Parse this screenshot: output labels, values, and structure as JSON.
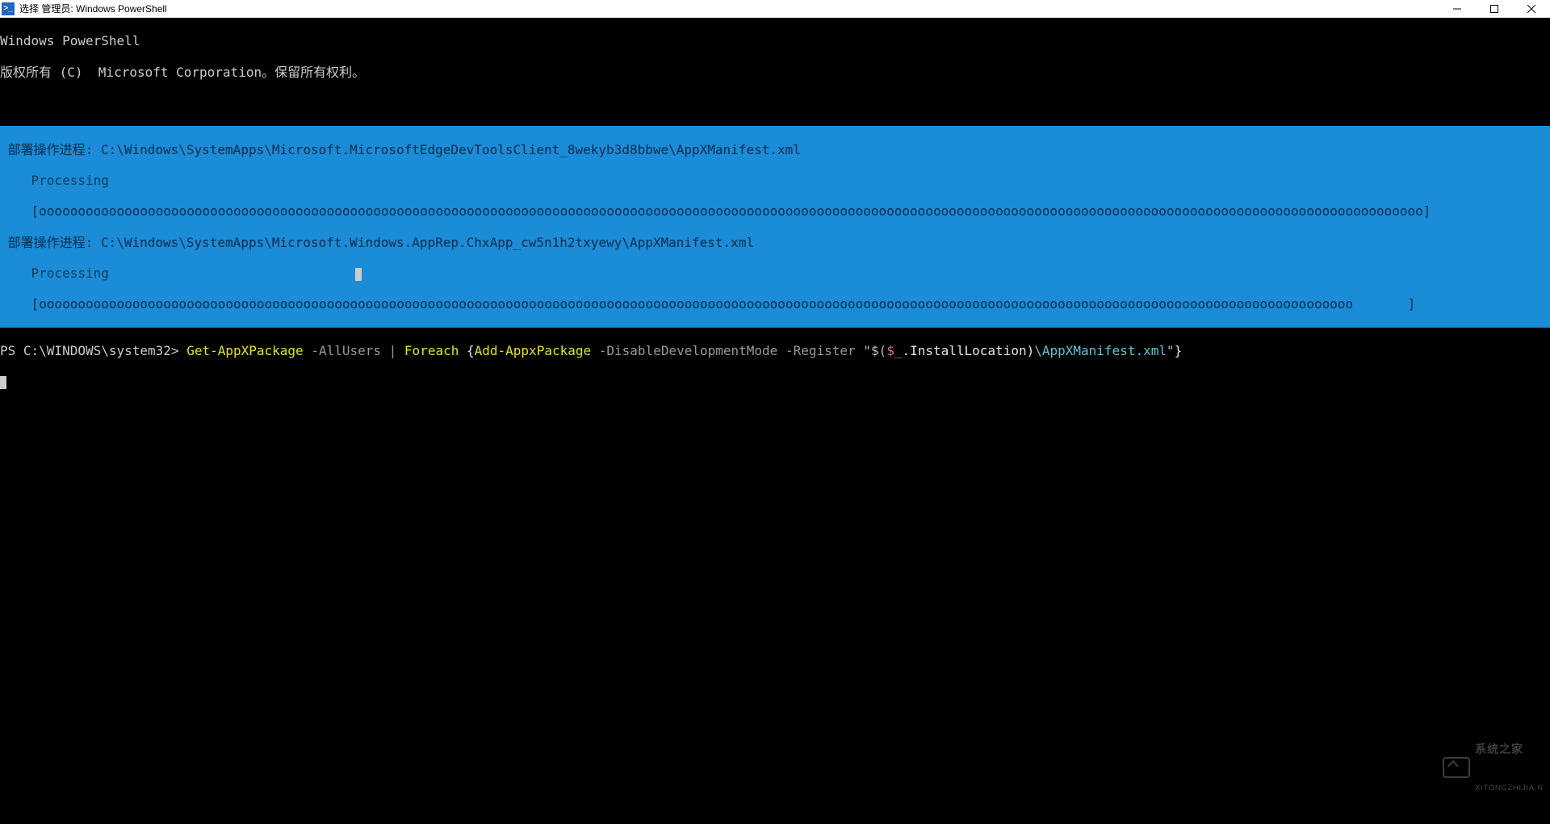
{
  "titlebar": {
    "icon_letter": ">_",
    "title": "选择 管理员: Windows PowerShell"
  },
  "header": {
    "line1": "Windows PowerShell",
    "line2": "版权所有 (C)  Microsoft Corporation。保留所有权利。"
  },
  "deploy": {
    "label": "部署操作进程:",
    "path1": "C:\\Windows\\SystemApps\\Microsoft.MicrosoftEdgeDevToolsClient_8wekyb3d8bbwe\\AppXManifest.xml",
    "path2": "C:\\Windows\\SystemApps\\Microsoft.Windows.AppRep.ChxApp_cw5n1h2txyewy\\AppXManifest.xml",
    "processing": "Processing",
    "bar1": "    [oooooooooooooooooooooooooooooooooooooooooooooooooooooooooooooooooooooooooooooooooooooooooooooooooooooooooooooooooooooooooooooooooooooooooooooooooooooooooooooooooooooooooooooooooo]",
    "bar2": "    [ooooooooooooooooooooooooooooooooooooooooooooooooooooooooooooooooooooooooooooooooooooooooooooooooooooooooooooooooooooooooooooooooooooooooooooooooooooooooooooooooooooooooo       ]"
  },
  "cmd": {
    "prompt": "PS C:\\WINDOWS\\system32> ",
    "get": "Get-AppXPackage",
    "allusers": " -AllUsers ",
    "pipe": "| ",
    "foreach": "Foreach",
    "brace_open": " {",
    "add": "Add-AppxPackage",
    "disable": " -DisableDevelopmentMode -Register ",
    "qstart": "\"$(",
    "var": "$_",
    "dot": ".",
    "prop": "InstallLocation",
    "close_sub": ")",
    "tail_path": "\\AppXManifest.xml",
    "qend": "\"",
    "brace_close": "}"
  },
  "watermark": {
    "top": "系统之家",
    "bottom": "XITONGZHIJIA.N"
  }
}
